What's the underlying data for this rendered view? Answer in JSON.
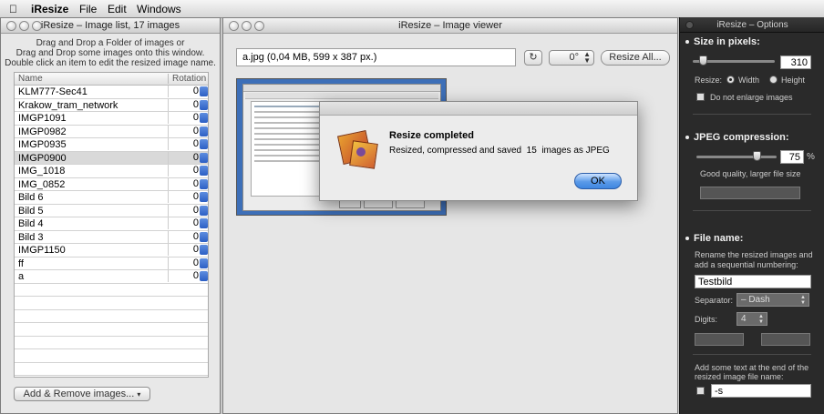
{
  "menubar": {
    "app": "iResize",
    "items": [
      "File",
      "Edit",
      "Windows"
    ]
  },
  "list_window": {
    "title": "iResize – Image list, 17 images",
    "hint": [
      "Drag and Drop a Folder of images or",
      "Drag and Drop some images onto this window.",
      "Double click an item to edit the resized image name."
    ],
    "col_name": "Name",
    "col_rotation": "Rotation",
    "rows": [
      {
        "name": "KLM777-Sec41",
        "rotation": "0"
      },
      {
        "name": "Krakow_tram_network",
        "rotation": "0"
      },
      {
        "name": "IMGP1091",
        "rotation": "0"
      },
      {
        "name": "IMGP0982",
        "rotation": "0"
      },
      {
        "name": "IMGP0935",
        "rotation": "0"
      },
      {
        "name": "IMGP0900",
        "rotation": "0"
      },
      {
        "name": "IMG_1018",
        "rotation": "0"
      },
      {
        "name": "IMG_0852",
        "rotation": "0"
      },
      {
        "name": "Bild 6",
        "rotation": "0"
      },
      {
        "name": "Bild 5",
        "rotation": "0"
      },
      {
        "name": "Bild 4",
        "rotation": "0"
      },
      {
        "name": "Bild 3",
        "rotation": "0"
      },
      {
        "name": "IMGP1150",
        "rotation": "0"
      },
      {
        "name": "ff",
        "rotation": "0"
      },
      {
        "name": "a",
        "rotation": "0"
      }
    ],
    "add_remove": "Add & Remove images..."
  },
  "viewer": {
    "title": "iResize – Image viewer",
    "info": "a.jpg  (0,04 MB, 599 x 387 px.)",
    "rotation": "0°",
    "resize_all": "Resize All..."
  },
  "dialog": {
    "title": "Resize completed",
    "message": "Resized, compressed and saved  15  images as JPEG",
    "ok": "OK"
  },
  "options": {
    "title": "iResize – Options",
    "size_heading": "Size in pixels:",
    "size_value": "310",
    "size_slider_fraction": 0.12,
    "resize_label": "Resize:",
    "width_label": "Width",
    "height_label": "Height",
    "no_enlarge": "Do not enlarge images",
    "jpeg_heading": "JPEG compression:",
    "jpeg_value": "75",
    "jpeg_unit": "%",
    "jpeg_slider_fraction": 0.75,
    "quality_text": "Good quality, larger file size",
    "file_heading": "File name:",
    "file_desc": [
      "Rename the resized images and",
      "add a sequential numbering:"
    ],
    "file_value": "Testbild",
    "separator_label": "Separator:",
    "separator_value": "– Dash",
    "digits_label": "Digits:",
    "digits_value": "4",
    "suffix_desc": [
      "Add some text at the end of the",
      "resized image file name:"
    ],
    "suffix_value": "-s"
  }
}
